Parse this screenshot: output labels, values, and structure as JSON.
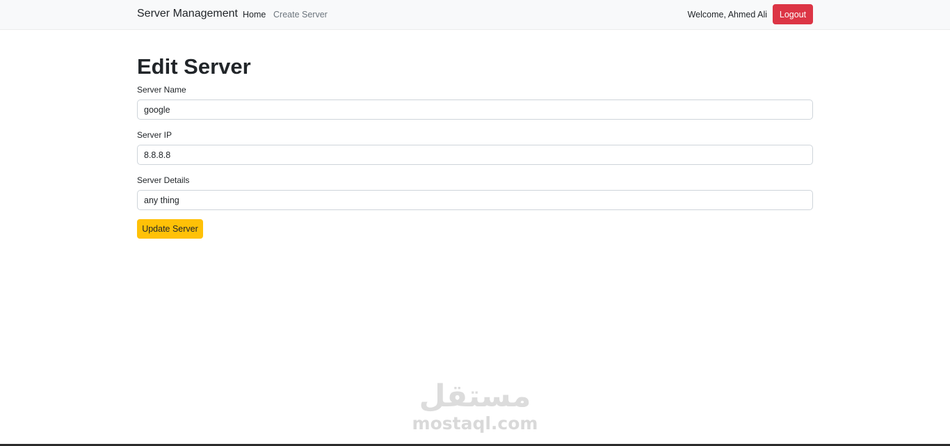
{
  "navbar": {
    "brand": "Server Management",
    "links": [
      {
        "label": "Home",
        "active": true
      },
      {
        "label": "Create Server",
        "active": false
      }
    ],
    "welcome": "Welcome, Ahmed Ali",
    "logout_label": "Logout"
  },
  "page": {
    "title": "Edit Server"
  },
  "form": {
    "server_name": {
      "label": "Server Name",
      "value": "google"
    },
    "server_ip": {
      "label": "Server IP",
      "value": "8.8.8.8"
    },
    "server_details": {
      "label": "Server Details",
      "value": "any thing"
    },
    "submit_label": "Update Server"
  },
  "watermark": {
    "arabic": "مستقل",
    "latin": "mostaql.com"
  },
  "colors": {
    "navbar_bg": "#f8f9fa",
    "logout_bg": "#dc3545",
    "update_bg": "#ffc107",
    "input_border": "#ced4da"
  }
}
